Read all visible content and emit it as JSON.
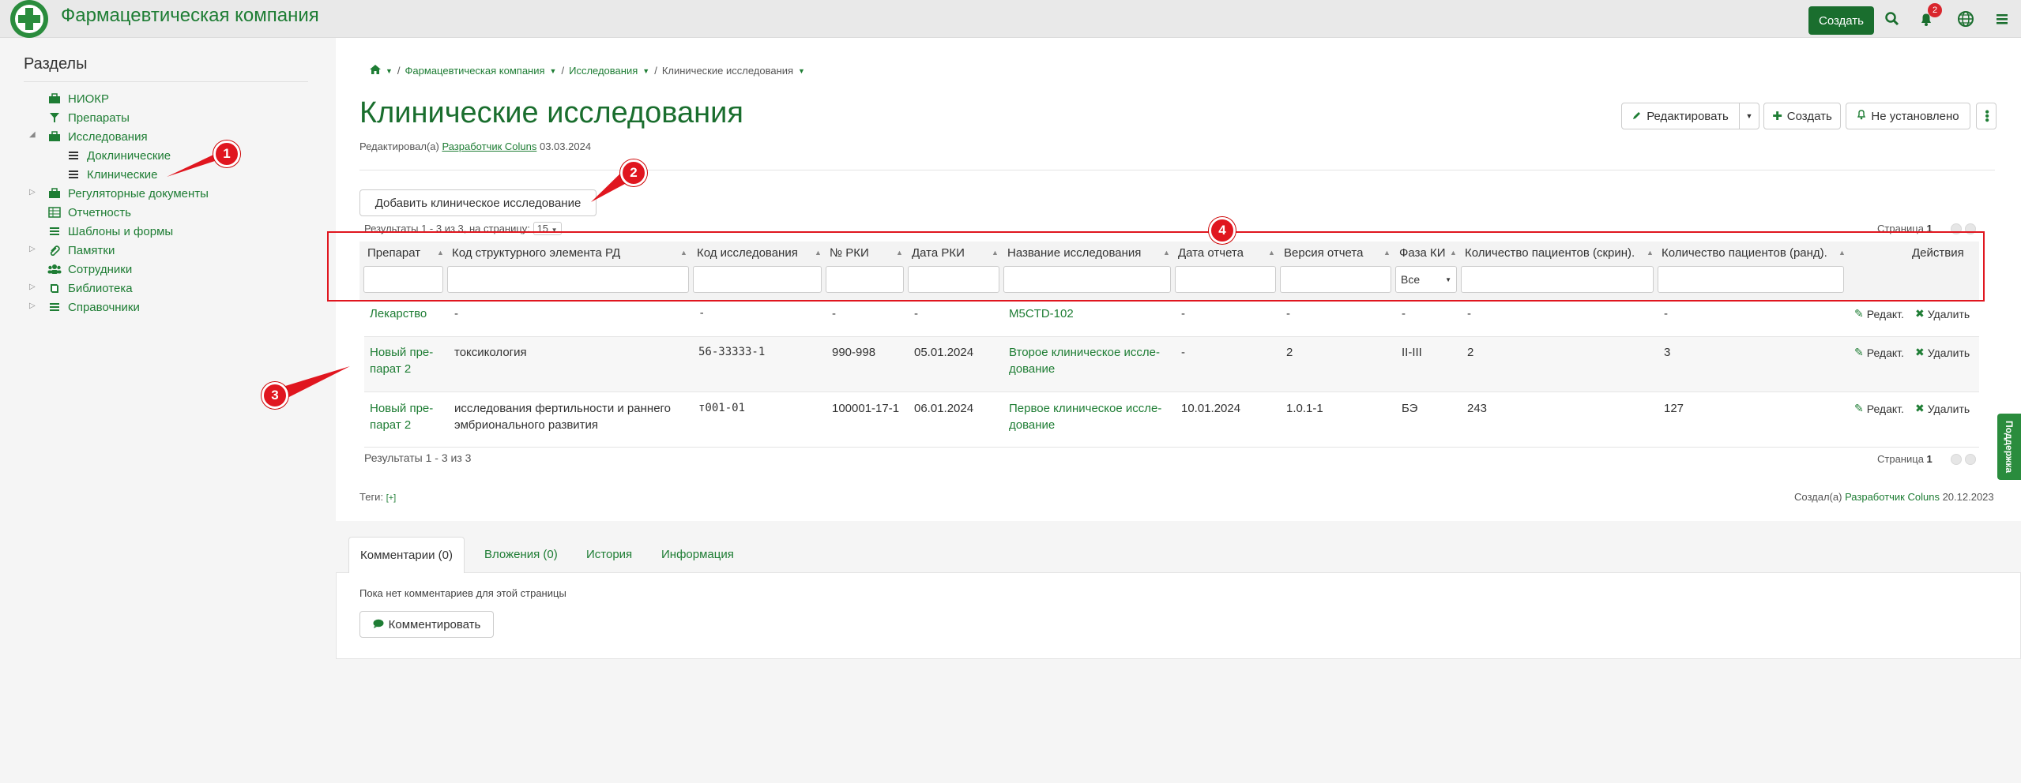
{
  "app": {
    "title": "Фармацевтическая компания",
    "create_label": "Создать",
    "notif_count": "2"
  },
  "sidebar": {
    "title": "Разделы",
    "items": [
      {
        "label": "НИОКР"
      },
      {
        "label": "Препараты"
      },
      {
        "label": "Исследования"
      },
      {
        "label": "Доклинические"
      },
      {
        "label": "Клинические"
      },
      {
        "label": "Регуляторные документы"
      },
      {
        "label": "Отчетность"
      },
      {
        "label": "Шаблоны и формы"
      },
      {
        "label": "Памятки"
      },
      {
        "label": "Сотрудники"
      },
      {
        "label": "Библиотека"
      },
      {
        "label": "Справочники"
      }
    ]
  },
  "breadcrumb": {
    "sep": "/",
    "c1": "Фармацевтическая компания",
    "c2": "Исследования",
    "c3": "Клинические исследования"
  },
  "page": {
    "title": "Клинические исследования",
    "edited_prefix": "Редактировал(а)",
    "edited_user": "Разработчик Coluns",
    "edited_date": "03.03.2024",
    "edit_label": "Редактировать",
    "create_label": "Создать",
    "status_label": "Не установлено",
    "add_label": "Добавить клиническое исследование",
    "results_top": "Результаты 1 - 3 из 3, на страницу:",
    "per_page": "15",
    "page_label": "Страница",
    "page_num": "1",
    "results_bottom": "Результаты 1 - 3 из 3",
    "tags_label": "Теги:",
    "tags_add": "[+]",
    "created_prefix": "Создал(а)",
    "created_user": "Разработчик Coluns",
    "created_date": "20.12.2023"
  },
  "table": {
    "headers": [
      "Препарат",
      "Код структурного элемента РД",
      "Код исследования",
      "№ РКИ",
      "Дата РКИ",
      "Название исследования",
      "Дата отчета",
      "Версия отчета",
      "Фаза КИ",
      "Количество пациентов (скрин).",
      "Количество пациентов (ранд).",
      "Действия"
    ],
    "phase_filter": "Все",
    "edit_action": "Редакт.",
    "delete_action": "Удалить",
    "rows": [
      {
        "drug1": "Лекарство",
        "drug2": "",
        "rd1": "-",
        "rd2": "",
        "code": "-",
        "rki": "-",
        "rki_date": "-",
        "name1": "M5CTD-102",
        "name2": "",
        "rep_date": "-",
        "rep_ver": "-",
        "phase": "-",
        "screen": "-",
        "rand": "-"
      },
      {
        "drug1": "Новый пре-",
        "drug2": "парат 2",
        "rd1": "токсикология",
        "rd2": "",
        "code": "56-33333-1",
        "rki": "990-998",
        "rki_date": "05.01.2024",
        "name1": "Второе клиническое иссле-",
        "name2": "дование",
        "rep_date": "-",
        "rep_ver": "2",
        "phase": "II-III",
        "screen": "2",
        "rand": "3"
      },
      {
        "drug1": "Новый пре-",
        "drug2": "парат 2",
        "rd1": "исследования фертильности и раннего",
        "rd2": "эмбрионального развития",
        "code": "т001-01",
        "rki": "100001-17-1",
        "rki_date": "06.01.2024",
        "name1": "Первое клиническое иссле-",
        "name2": "дование",
        "rep_date": "10.01.2024",
        "rep_ver": "1.0.1-1",
        "phase": "БЭ",
        "screen": "243",
        "rand": "127"
      }
    ]
  },
  "comments": {
    "tabs": [
      "Комментарии (0)",
      "Вложения (0)",
      "История",
      "Информация"
    ],
    "empty": "Пока нет комментариев для этой страницы",
    "button": "Комментировать"
  },
  "support_label": "Поддержка",
  "markers": [
    "1",
    "2",
    "3",
    "4"
  ],
  "colors": {
    "brand": "#1e7d34",
    "marker": "#e0161f"
  }
}
